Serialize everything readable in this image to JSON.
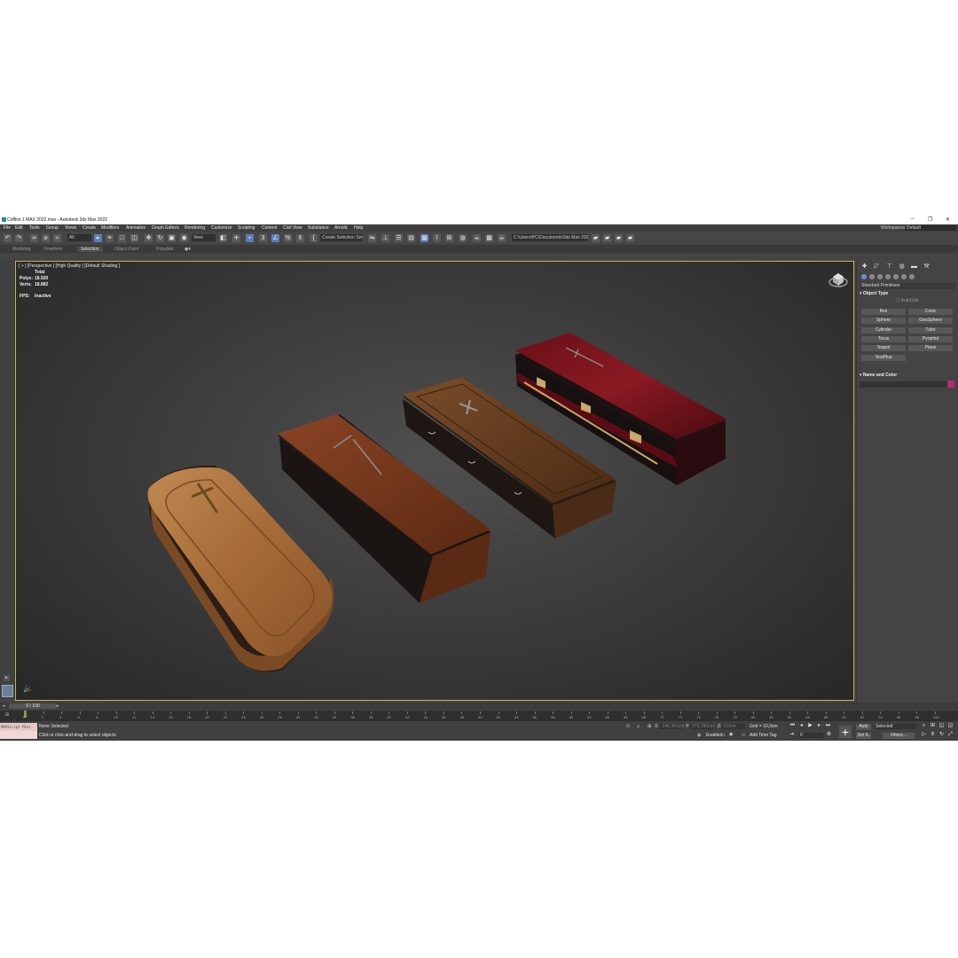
{
  "window": {
    "title": "Coffins 1 MAX 2022.max - Autodesk 3ds Max 2022",
    "min": "–",
    "max": "❐",
    "close": "✕"
  },
  "menu": [
    "File",
    "Edit",
    "Tools",
    "Group",
    "Views",
    "Create",
    "Modifiers",
    "Animation",
    "Graph Editors",
    "Rendering",
    "Customize",
    "Scripting",
    "Content",
    "Civil View",
    "Substance",
    "Arnold",
    "Help"
  ],
  "workspace": {
    "label": "Workspaces:",
    "value": "Default"
  },
  "toolbar": {
    "filter": "All",
    "view": "View",
    "selection_set": "Create Selection Set",
    "project_path": "C:\\Users\\PC\\Documents\\3ds Max 2022"
  },
  "ribbon_tabs": [
    "Modeling",
    "Freeform",
    "Selection",
    "Object Paint",
    "Populate"
  ],
  "ribbon_active": "Selection",
  "viewport": {
    "label": "[ + ] [Perspective ] [High Quality ] [Default Shading ]",
    "total_label": "Total",
    "polys_label": "Polys:",
    "polys": "18.920",
    "verts_label": "Verts:",
    "verts": "18.882",
    "fps_label": "FPS:",
    "fps": "Inactive"
  },
  "command_panel": {
    "category": "Standard Primitives",
    "object_type_title": "Object Type",
    "autogrid": "AutoGrid",
    "buttons": [
      "Box",
      "Cone",
      "Sphere",
      "GeoSphere",
      "Cylinder",
      "Tube",
      "Torus",
      "Pyramid",
      "Teapot",
      "Plane",
      "TextPlus"
    ],
    "name_color_title": "Name and Color",
    "color": "#c8237a"
  },
  "time": {
    "slider": "0 / 100",
    "ticks": [
      "0",
      "2",
      "4",
      "6",
      "8",
      "10",
      "12",
      "14",
      "16",
      "18",
      "20",
      "22",
      "24",
      "26",
      "28",
      "30",
      "32",
      "34",
      "36",
      "38",
      "40",
      "42",
      "44",
      "46",
      "48",
      "50",
      "52",
      "54",
      "56",
      "58",
      "60",
      "62",
      "64",
      "66",
      "68",
      "70",
      "72",
      "74",
      "76",
      "78",
      "80",
      "82",
      "84",
      "86",
      "88",
      "90",
      "92",
      "94",
      "96",
      "98",
      "100"
    ]
  },
  "status": {
    "maxscript": "MAXScript Mini",
    "line1": "None Selected",
    "line2": "Click or click-and-drag to select objects",
    "x_label": "X:",
    "x": "-246,361cm",
    "y_label": "Y:",
    "y": "273,796cm",
    "z_label": "Z:",
    "z": "0,0cm",
    "grid": "Grid = 10,0cm",
    "enabled": "Enabled:",
    "add_time_tag": "Add Time Tag",
    "frame": "0",
    "auto": "Auto",
    "selected": "Selected",
    "set_k": "Set K.",
    "filters": "Filters..."
  }
}
